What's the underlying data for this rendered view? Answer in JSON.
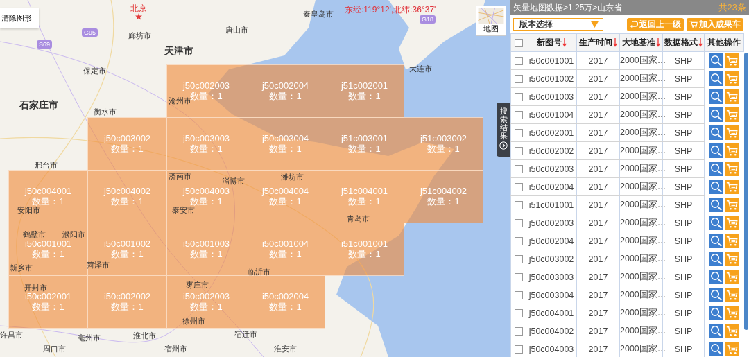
{
  "map": {
    "clear_button": "清除图形",
    "coordinates": "东经:119°12',北纬:36°37'",
    "map_type_label": "地图",
    "side_tab": "搜索结果",
    "roads": [
      "G95",
      "S69",
      "G18"
    ],
    "cities": [
      {
        "name": "北京",
        "kind": "capital"
      },
      {
        "name": "廊坊市",
        "kind": "city"
      },
      {
        "name": "唐山市",
        "kind": "city"
      },
      {
        "name": "天津市",
        "kind": "major"
      },
      {
        "name": "秦皇岛市",
        "kind": "city"
      },
      {
        "name": "保定市",
        "kind": "city"
      },
      {
        "name": "石家庄市",
        "kind": "major"
      },
      {
        "name": "沧州市",
        "kind": "city"
      },
      {
        "name": "大连市",
        "kind": "city"
      },
      {
        "name": "衡水市",
        "kind": "city"
      },
      {
        "name": "邢台市",
        "kind": "city"
      },
      {
        "name": "安阳市",
        "kind": "city"
      },
      {
        "name": "济南市",
        "kind": "city"
      },
      {
        "name": "淄博市",
        "kind": "city"
      },
      {
        "name": "潍坊市",
        "kind": "city"
      },
      {
        "name": "泰安市",
        "kind": "city"
      },
      {
        "name": "青岛市",
        "kind": "city"
      },
      {
        "name": "鹤壁市",
        "kind": "city"
      },
      {
        "name": "濮阳市",
        "kind": "city"
      },
      {
        "name": "新乡市",
        "kind": "city"
      },
      {
        "name": "菏泽市",
        "kind": "city"
      },
      {
        "name": "临沂市",
        "kind": "city"
      },
      {
        "name": "开封市",
        "kind": "city"
      },
      {
        "name": "枣庄市",
        "kind": "city"
      },
      {
        "name": "徐州市",
        "kind": "city"
      },
      {
        "name": "许昌市",
        "kind": "city"
      },
      {
        "name": "亳州市",
        "kind": "city"
      },
      {
        "name": "淮北市",
        "kind": "city"
      },
      {
        "name": "宿迁市",
        "kind": "city"
      },
      {
        "name": "周口市",
        "kind": "city"
      },
      {
        "name": "宿州市",
        "kind": "city"
      },
      {
        "name": "淮安市",
        "kind": "city"
      }
    ],
    "grid": [
      [
        {
          "code": "j50c002003",
          "count": "数量：1"
        },
        {
          "code": "j50c002004",
          "count": "数量：1"
        },
        {
          "code": "j51c002001",
          "count": "数量：1"
        }
      ],
      [
        {
          "code": "j50c003002",
          "count": "数量：1"
        },
        {
          "code": "j50c003003",
          "count": "数量：1"
        },
        {
          "code": "j50c003004",
          "count": "数量：1"
        },
        {
          "code": "j51c003001",
          "count": "数量：1"
        },
        {
          "code": "j51c003002",
          "count": "数量：1"
        }
      ],
      [
        {
          "code": "j50c004001",
          "count": "数量：1"
        },
        {
          "code": "j50c004002",
          "count": "数量：1"
        },
        {
          "code": "j50c004003",
          "count": "数量：1"
        },
        {
          "code": "j50c004004",
          "count": "数量：1"
        },
        {
          "code": "j51c004001",
          "count": "数量：1"
        },
        {
          "code": "j51c004002",
          "count": "数量：1"
        }
      ],
      [
        {
          "code": "i50c001001",
          "count": "数量：1"
        },
        {
          "code": "i50c001002",
          "count": "数量：1"
        },
        {
          "code": "i50c001003",
          "count": "数量：1"
        },
        {
          "code": "i50c001004",
          "count": "数量：1"
        },
        {
          "code": "i51c001001",
          "count": "数量：1"
        }
      ],
      [
        {
          "code": "i50c002001",
          "count": "数量：1"
        },
        {
          "code": "i50c002002",
          "count": "数量：1"
        },
        {
          "code": "i50c002003",
          "count": "数量：1"
        },
        {
          "code": "i50c002004",
          "count": "数量：1"
        }
      ]
    ]
  },
  "panel": {
    "breadcrumb": "矢量地图数据>1:25万>山东省",
    "total": "共23条",
    "version_select": "版本选择",
    "buttons": [
      {
        "label": "返回上一级",
        "kind": "back"
      },
      {
        "label": "加入成果车",
        "kind": "cart"
      }
    ],
    "table": {
      "columns": [
        {
          "label": "新图号",
          "sortable": true
        },
        {
          "label": "生产时间",
          "sortable": true
        },
        {
          "label": "大地基准",
          "sortable": true
        },
        {
          "label": "数据格式",
          "sortable": true
        },
        {
          "label": "其他操作",
          "sortable": false
        }
      ],
      "all_checked": false,
      "rows": [
        {
          "checked": false,
          "cells": [
            "i50c001001",
            "2017",
            "2000国家…",
            "SHP"
          ]
        },
        {
          "checked": false,
          "cells": [
            "i50c001002",
            "2017",
            "2000国家…",
            "SHP"
          ]
        },
        {
          "checked": false,
          "cells": [
            "i50c001003",
            "2017",
            "2000国家…",
            "SHP"
          ]
        },
        {
          "checked": false,
          "cells": [
            "i50c001004",
            "2017",
            "2000国家…",
            "SHP"
          ]
        },
        {
          "checked": false,
          "cells": [
            "i50c002001",
            "2017",
            "2000国家…",
            "SHP"
          ]
        },
        {
          "checked": false,
          "cells": [
            "i50c002002",
            "2017",
            "2000国家…",
            "SHP"
          ]
        },
        {
          "checked": false,
          "cells": [
            "i50c002003",
            "2017",
            "2000国家…",
            "SHP"
          ]
        },
        {
          "checked": false,
          "cells": [
            "i50c002004",
            "2017",
            "2000国家…",
            "SHP"
          ]
        },
        {
          "checked": false,
          "cells": [
            "i51c001001",
            "2017",
            "2000国家…",
            "SHP"
          ]
        },
        {
          "checked": false,
          "cells": [
            "j50c002003",
            "2017",
            "2000国家…",
            "SHP"
          ]
        },
        {
          "checked": false,
          "cells": [
            "j50c002004",
            "2017",
            "2000国家…",
            "SHP"
          ]
        },
        {
          "checked": false,
          "cells": [
            "j50c003002",
            "2017",
            "2000国家…",
            "SHP"
          ]
        },
        {
          "checked": false,
          "cells": [
            "j50c003003",
            "2017",
            "2000国家…",
            "SHP"
          ]
        },
        {
          "checked": false,
          "cells": [
            "j50c003004",
            "2017",
            "2000国家…",
            "SHP"
          ]
        },
        {
          "checked": false,
          "cells": [
            "j50c004001",
            "2017",
            "2000国家…",
            "SHP"
          ]
        },
        {
          "checked": false,
          "cells": [
            "j50c004002",
            "2017",
            "2000国家…",
            "SHP"
          ]
        },
        {
          "checked": false,
          "cells": [
            "j50c004003",
            "2017",
            "2000国家…",
            "SHP"
          ]
        }
      ]
    }
  }
}
